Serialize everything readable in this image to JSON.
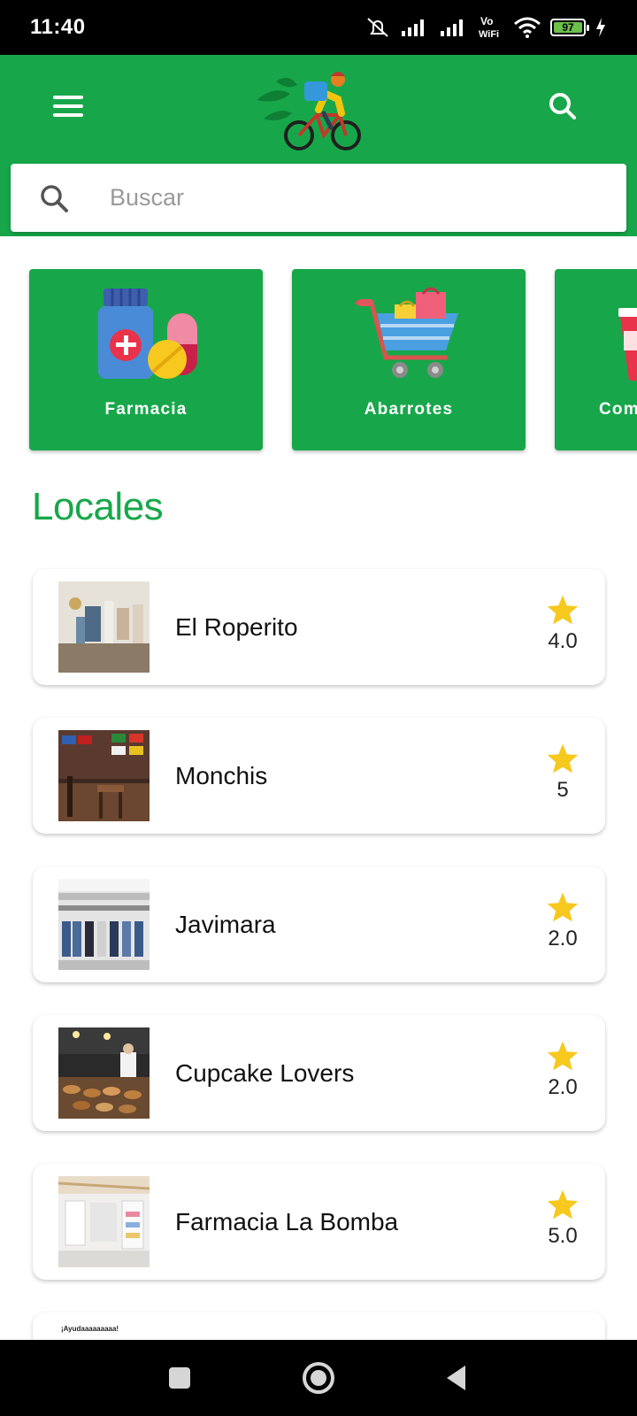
{
  "status_bar": {
    "time": "11:40",
    "battery_percent": "97",
    "vowifi_top": "Vo",
    "vowifi_bottom": "WiFi"
  },
  "app_bar": {
    "menu_icon": "hamburger-menu-icon",
    "logo_icon": "bicycle-courier-logo",
    "search_icon": "search-icon",
    "color": "#17a74a"
  },
  "search": {
    "placeholder": "Buscar",
    "value": ""
  },
  "categories": [
    {
      "label": "Farmacia",
      "icon": "pharmacy-icon"
    },
    {
      "label": "Abarrotes",
      "icon": "shopping-cart-icon"
    },
    {
      "label": "Com",
      "icon": "drink-cup-icon"
    }
  ],
  "section": {
    "title": "Locales"
  },
  "stores": [
    {
      "name": "El Roperito",
      "rating": "4.0"
    },
    {
      "name": "Monchis",
      "rating": "5"
    },
    {
      "name": "Javimara",
      "rating": "2.0"
    },
    {
      "name": "Cupcake Lovers",
      "rating": "2.0"
    },
    {
      "name": "Farmacia La Bomba",
      "rating": "5.0"
    }
  ],
  "partial_store": {
    "text": "¡Ayudaaaaaaaaa!"
  },
  "colors": {
    "primary": "#17a74a",
    "star": "#f7c81e",
    "background": "#ffffff"
  }
}
